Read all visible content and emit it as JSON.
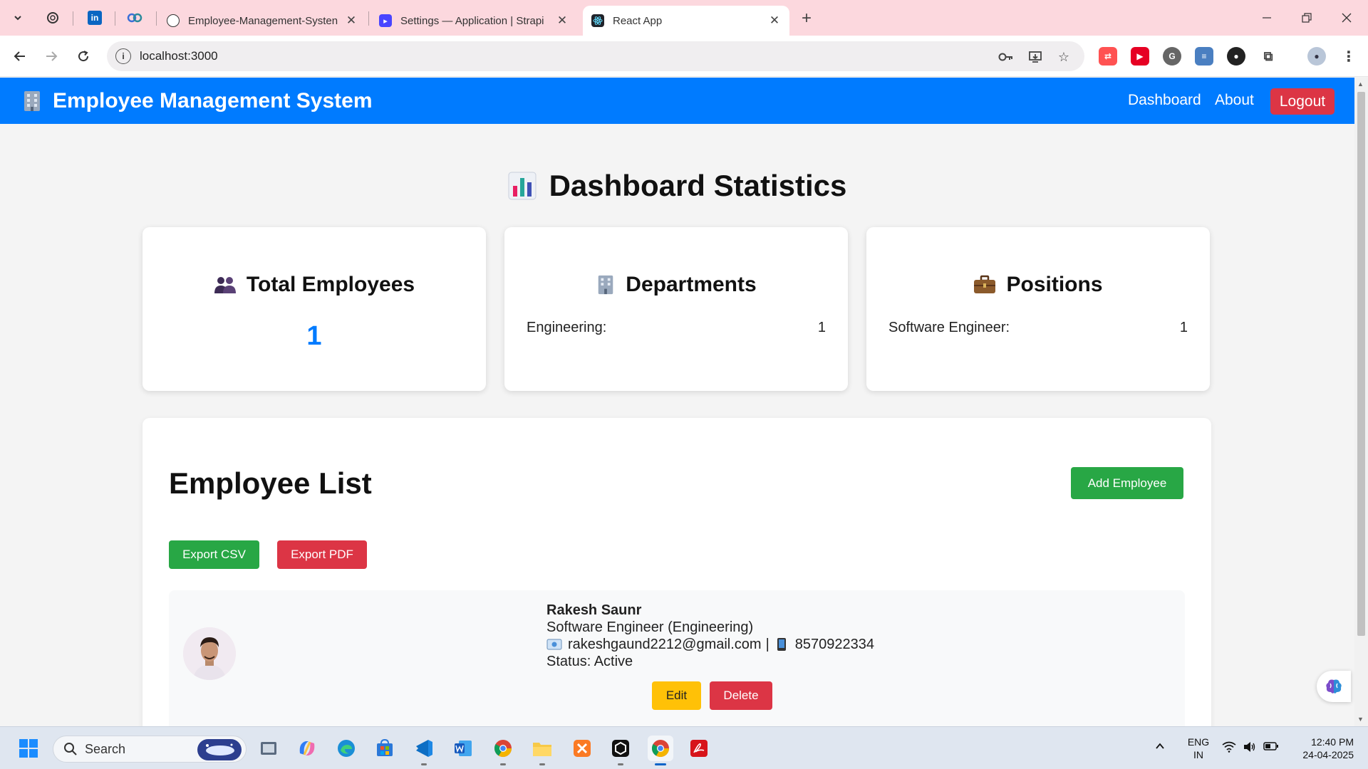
{
  "browser": {
    "tabs": [
      {
        "title": "Employee-Management-Systen",
        "favicon": "github-icon",
        "active": false
      },
      {
        "title": "Settings — Application | Strapi",
        "favicon": "strapi-icon",
        "active": false
      },
      {
        "title": "React App",
        "favicon": "react-icon",
        "active": true
      }
    ],
    "close_glyph": "✕",
    "new_tab_glyph": "+",
    "url": "localhost:3000"
  },
  "app": {
    "brand": "Employee Management System",
    "nav": {
      "dashboard": "Dashboard",
      "about": "About",
      "logout": "Logout"
    },
    "accent": "#007bff",
    "danger": "#dc3545",
    "success": "#28a745",
    "warning": "#ffc107"
  },
  "dashboard": {
    "title": "Dashboard Statistics",
    "total_employees": {
      "label": "Total Employees",
      "value": "1"
    },
    "departments": {
      "label": "Departments",
      "rows": [
        {
          "name": "Engineering:",
          "count": "1"
        }
      ]
    },
    "positions": {
      "label": "Positions",
      "rows": [
        {
          "name": "Software Engineer:",
          "count": "1"
        }
      ]
    }
  },
  "employee_list": {
    "title": "Employee List",
    "add_button": "Add Employee",
    "export_csv": "Export CSV",
    "export_pdf": "Export PDF",
    "employees": [
      {
        "name": "Rakesh Saunr",
        "role": "Software Engineer (Engineering)",
        "email": "rakeshgaund2212@gmail.com",
        "separator": "|",
        "phone": "8570922334",
        "status": "Status: Active",
        "edit": "Edit",
        "delete": "Delete"
      }
    ]
  },
  "taskbar": {
    "search": "Search",
    "lang_top": "ENG",
    "lang_bottom": "IN",
    "time": "12:40 PM",
    "date": "24-04-2025"
  }
}
